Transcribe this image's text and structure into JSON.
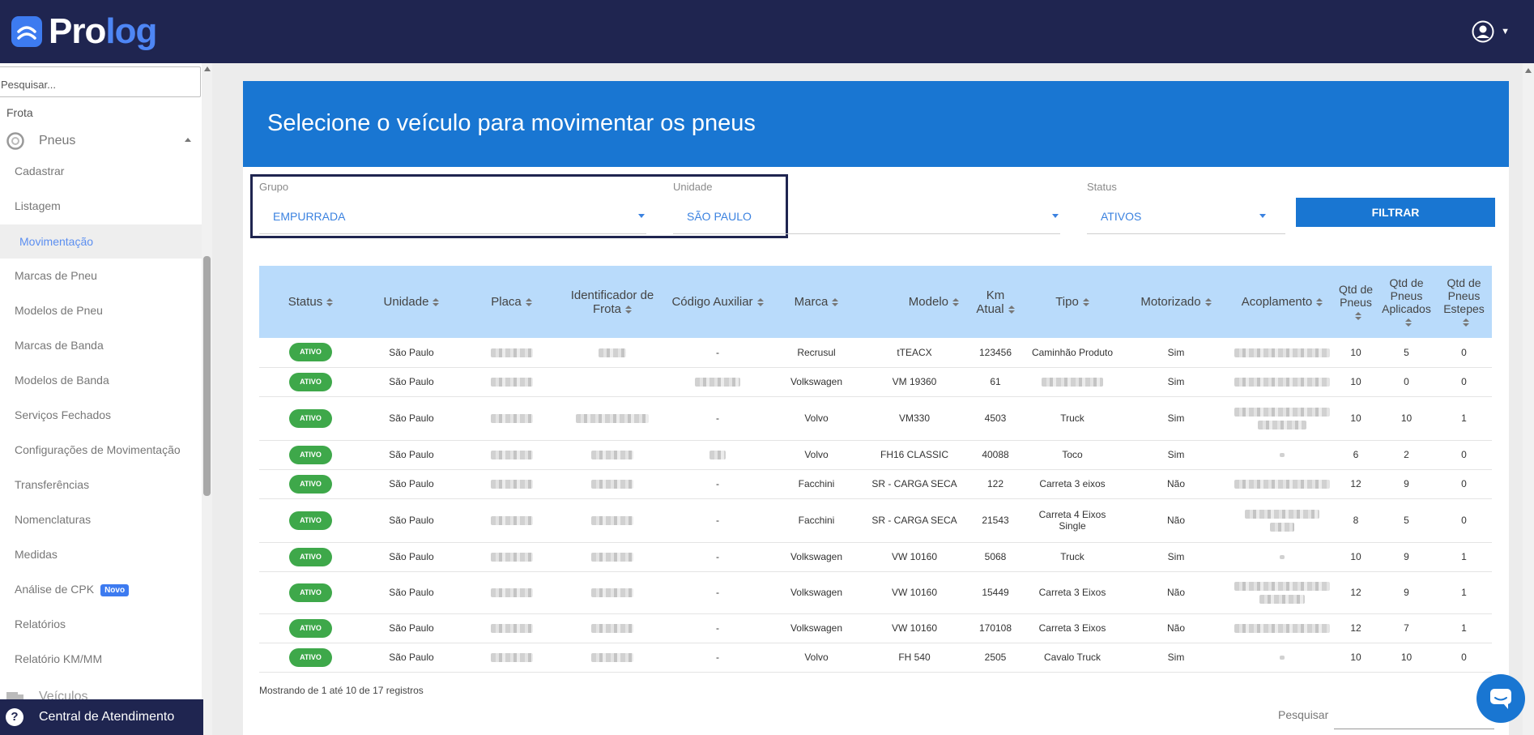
{
  "app": {
    "logo_text_a": "Pro",
    "logo_text_b": "log",
    "brand_color": "#1f2550",
    "accent": "#1976d2"
  },
  "sidebar": {
    "search_placeholder": "Pesquisar...",
    "section_frota": "Frota",
    "section_pneus": "Pneus",
    "items": [
      {
        "label": "Cadastrar"
      },
      {
        "label": "Listagem"
      },
      {
        "label": "Movimentação"
      },
      {
        "label": "Marcas de Pneu"
      },
      {
        "label": "Modelos de Pneu"
      },
      {
        "label": "Marcas de Banda"
      },
      {
        "label": "Modelos de Banda"
      },
      {
        "label": "Serviços Fechados"
      },
      {
        "label": "Configurações de Movimentação"
      },
      {
        "label": "Transferências"
      },
      {
        "label": "Nomenclaturas"
      },
      {
        "label": "Medidas"
      },
      {
        "label": "Análise de CPK"
      },
      {
        "label": "Relatórios"
      },
      {
        "label": "Relatório KM/MM"
      }
    ],
    "active_item": "Movimentação",
    "new_badge": "Novo",
    "section_veiculos": "Veículos",
    "support_label": "Central de Atendimento"
  },
  "page": {
    "title": "Selecione o veículo para movimentar os pneus"
  },
  "filters": {
    "grupo_label": "Grupo",
    "grupo_value": "EMPURRADA",
    "unidade_label": "Unidade",
    "unidade_value": "SÃO PAULO",
    "status_label": "Status",
    "status_value": "ATIVOS",
    "filter_button": "FILTRAR"
  },
  "table": {
    "headers": {
      "status": "Status",
      "unidade": "Unidade",
      "placa": "Placa",
      "identificador_a": "Identificador de",
      "identificador_b": "Frota",
      "codigo": "Código Auxiliar",
      "marca": "Marca",
      "modelo": "Modelo",
      "km_a": "Km",
      "km_b": "Atual",
      "tipo": "Tipo",
      "motorizado": "Motorizado",
      "acoplamento": "Acoplamento",
      "qtd_a": "Qtd de",
      "qtd_b": "Pneus",
      "aplic_a": "Qtd de",
      "aplic_b": "Pneus",
      "aplic_c": "Aplicados",
      "estepes_a": "Qtd de",
      "estepes_b": "Pneus",
      "estepes_c": "Estepes"
    },
    "rows": [
      {
        "status": "ATIVO",
        "unidade": "São Paulo",
        "codigo": "-",
        "marca": "Recrusul",
        "modelo": "tTEACX",
        "km": "123456",
        "tipo": "Caminhão Produto",
        "motorizado": "Sim",
        "qtd": "10",
        "aplicados": "5",
        "estepes": "0"
      },
      {
        "status": "ATIVO",
        "unidade": "São Paulo",
        "codigo": "",
        "marca": "Volkswagen",
        "modelo": "VM 19360",
        "km": "61",
        "tipo": "",
        "motorizado": "Sim",
        "qtd": "10",
        "aplicados": "0",
        "estepes": "0"
      },
      {
        "status": "ATIVO",
        "unidade": "São Paulo",
        "codigo": "-",
        "marca": "Volvo",
        "modelo": "VM330",
        "km": "4503",
        "tipo": "Truck",
        "motorizado": "Sim",
        "qtd": "10",
        "aplicados": "10",
        "estepes": "1"
      },
      {
        "status": "ATIVO",
        "unidade": "São Paulo",
        "codigo": "",
        "marca": "Volvo",
        "modelo": "FH16 CLASSIC",
        "km": "40088",
        "tipo": "Toco",
        "motorizado": "Sim",
        "qtd": "6",
        "aplicados": "2",
        "estepes": "0"
      },
      {
        "status": "ATIVO",
        "unidade": "São Paulo",
        "codigo": "-",
        "marca": "Facchini",
        "modelo": "SR - CARGA SECA",
        "km": "122",
        "tipo": "Carreta 3 eixos",
        "motorizado": "Não",
        "qtd": "12",
        "aplicados": "9",
        "estepes": "0"
      },
      {
        "status": "ATIVO",
        "unidade": "São Paulo",
        "codigo": "-",
        "marca": "Facchini",
        "modelo": "SR - CARGA SECA",
        "km": "21543",
        "tipo": "Carreta 4 Eixos Single",
        "motorizado": "Não",
        "qtd": "8",
        "aplicados": "5",
        "estepes": "0"
      },
      {
        "status": "ATIVO",
        "unidade": "São Paulo",
        "codigo": "-",
        "marca": "Volkswagen",
        "modelo": "VW 10160",
        "km": "5068",
        "tipo": "Truck",
        "motorizado": "Sim",
        "qtd": "10",
        "aplicados": "9",
        "estepes": "1"
      },
      {
        "status": "ATIVO",
        "unidade": "São Paulo",
        "codigo": "-",
        "marca": "Volkswagen",
        "modelo": "VW 10160",
        "km": "15449",
        "tipo": "Carreta 3 Eixos",
        "motorizado": "Não",
        "qtd": "12",
        "aplicados": "9",
        "estepes": "1"
      },
      {
        "status": "ATIVO",
        "unidade": "São Paulo",
        "codigo": "-",
        "marca": "Volkswagen",
        "modelo": "VW 10160",
        "km": "170108",
        "tipo": "Carreta 3 Eixos",
        "motorizado": "Não",
        "qtd": "12",
        "aplicados": "7",
        "estepes": "1"
      },
      {
        "status": "ATIVO",
        "unidade": "São Paulo",
        "codigo": "-",
        "marca": "Volvo",
        "modelo": "FH 540",
        "km": "2505",
        "tipo": "Cavalo Truck",
        "motorizado": "Sim",
        "qtd": "10",
        "aplicados": "10",
        "estepes": "0"
      }
    ],
    "footer_info": "Mostrando de 1 até 10 de 17 registros",
    "search_label": "Pesquisar"
  },
  "icons": {
    "user": "user-circle-icon",
    "tire": "tire-icon",
    "help": "help-circle-icon",
    "chat": "chat-icon"
  }
}
